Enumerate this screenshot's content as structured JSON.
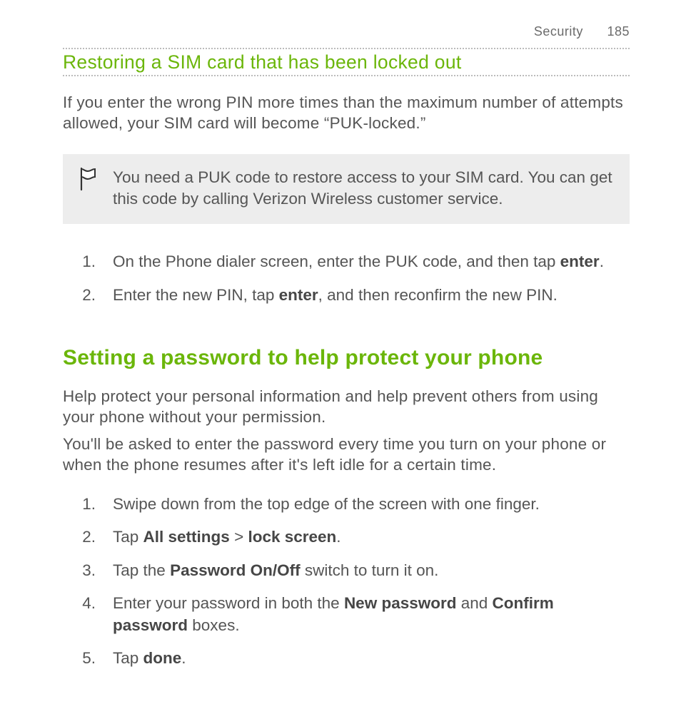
{
  "header": {
    "section": "Security",
    "page": "185"
  },
  "section1": {
    "title": "Restoring a SIM card that has been locked out",
    "intro": "If you enter the wrong PIN more times than the maximum number of attempts allowed, your SIM card will become “PUK-locked.”",
    "note": "You need a PUK code to restore access to your SIM card. You can get this code by calling Verizon Wireless customer service.",
    "steps": {
      "s1_a": "On the Phone dialer screen, enter the PUK code, and then tap ",
      "s1_bold": "enter",
      "s1_b": ".",
      "s2_a": "Enter the new PIN, tap ",
      "s2_bold": "enter",
      "s2_b": ", and then reconfirm the new PIN."
    }
  },
  "section2": {
    "title": "Setting a password to help protect your phone",
    "para1": "Help protect your personal information and help prevent others from using your phone without your permission.",
    "para2": "You'll be asked to enter the password every time you turn on your phone or when the phone resumes after it's left idle for a certain time.",
    "steps": {
      "s1": "Swipe down from the top edge of the screen with one finger.",
      "s2_a": "Tap ",
      "s2_b1": "All settings",
      "s2_gt": " > ",
      "s2_b2": "lock screen",
      "s2_c": ".",
      "s3_a": "Tap the ",
      "s3_b": "Password On/Off",
      "s3_c": " switch to turn it on.",
      "s4_a": "Enter your password in both the ",
      "s4_b1": "New password",
      "s4_mid": " and ",
      "s4_b2": "Confirm password",
      "s4_c": " boxes.",
      "s5_a": "Tap ",
      "s5_b": "done",
      "s5_c": "."
    }
  },
  "nums": {
    "n1": "1.",
    "n2": "2.",
    "n3": "3.",
    "n4": "4.",
    "n5": "5."
  }
}
